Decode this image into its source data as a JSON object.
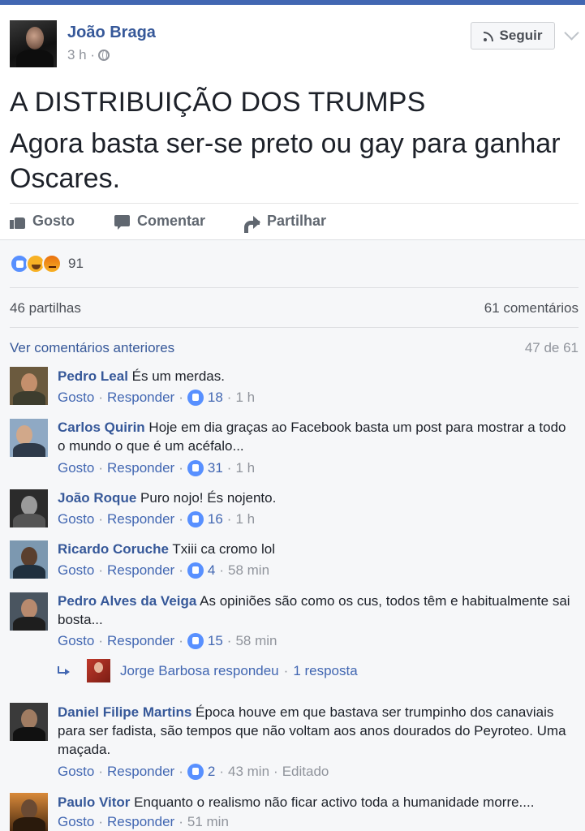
{
  "post": {
    "author": "João Braga",
    "time": "3 h ·",
    "follow_label": "Seguir",
    "headline": "A DISTRIBUIÇÃO DOS TRUMPS",
    "body": "Agora basta ser-se preto ou gay para ganhar Oscares.",
    "actions": {
      "like": "Gosto",
      "comment": "Comentar",
      "share": "Partilhar"
    }
  },
  "stats": {
    "reaction_count": "91",
    "reactions": [
      "like-icon",
      "haha-icon",
      "angry-icon"
    ],
    "shares": "46 partilhas",
    "comments": "61 comentários"
  },
  "comments_section": {
    "prev_link": "Ver comentários anteriores",
    "pager": "47 de 61",
    "like_label": "Gosto",
    "reply_label": "Responder",
    "items": [
      {
        "name": "Pedro Leal",
        "text": "És um merdas.",
        "likes": "18",
        "time": "1 h"
      },
      {
        "name": "Carlos Quirin",
        "text": "Hoje em dia graças ao Facebook basta um post para mostrar a todo o mundo o que é um acéfalo...",
        "likes": "31",
        "time": "1 h"
      },
      {
        "name": "João Roque",
        "text": "Puro nojo! És nojento.",
        "likes": "16",
        "time": "1 h"
      },
      {
        "name": "Ricardo Coruche",
        "text": "Txiii ca cromo lol",
        "likes": "4",
        "time": "58 min"
      },
      {
        "name": "Pedro Alves da Veiga",
        "text": "As opiniões são como os cus, todos têm e habitualmente sai bosta...",
        "likes": "15",
        "time": "58 min"
      },
      {
        "name": "Daniel Filipe Martins",
        "text": "Época houve em que bastava ser trumpinho dos canaviais para ser fadista, são tempos que não voltam aos anos dourados do Peyroteo. Uma maçada.",
        "likes": "2",
        "time": "43 min",
        "edited": "Editado"
      },
      {
        "name": "Paulo Vitor",
        "text": "Enquanto o realismo não ficar activo toda a humanidade morre....",
        "time": "51 min"
      }
    ],
    "reply": {
      "text": "Jorge Barbosa respondeu",
      "count": "1 resposta"
    }
  }
}
